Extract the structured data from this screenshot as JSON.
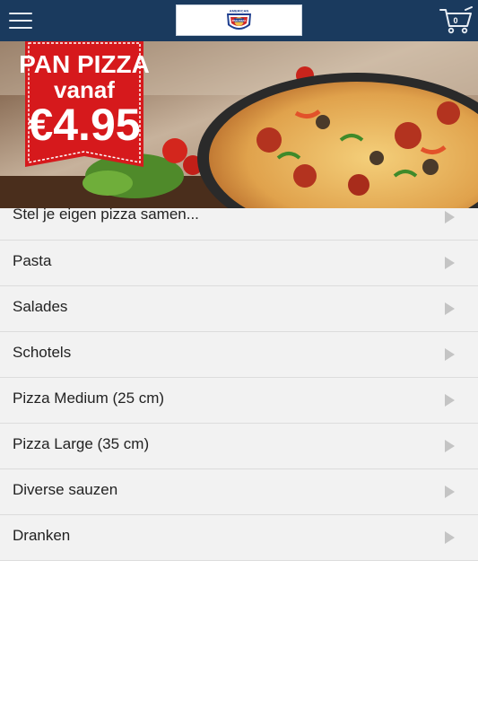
{
  "header": {
    "menu_icon": "hamburger-menu-icon",
    "cart_icon": "shopping-cart-icon",
    "cart_count": "0",
    "brand_color": "#1a3a5e"
  },
  "logo": {
    "top_text": "AMERICAN",
    "main_text": "PAN PIZZA"
  },
  "banner": {
    "line1": "PAN PIZZA",
    "line2": "vanaf",
    "price": "€4.95",
    "accent_color": "#d6191c"
  },
  "menu": {
    "arrow_icon": "chevron-right-icon",
    "items": [
      {
        "label": "Stel je eigen pizza samen..."
      },
      {
        "label": "Pasta"
      },
      {
        "label": "Salades"
      },
      {
        "label": "Schotels"
      },
      {
        "label": "Pizza Medium (25 cm)"
      },
      {
        "label": "Pizza Large (35 cm)"
      },
      {
        "label": "Diverse sauzen"
      },
      {
        "label": "Dranken"
      }
    ]
  }
}
